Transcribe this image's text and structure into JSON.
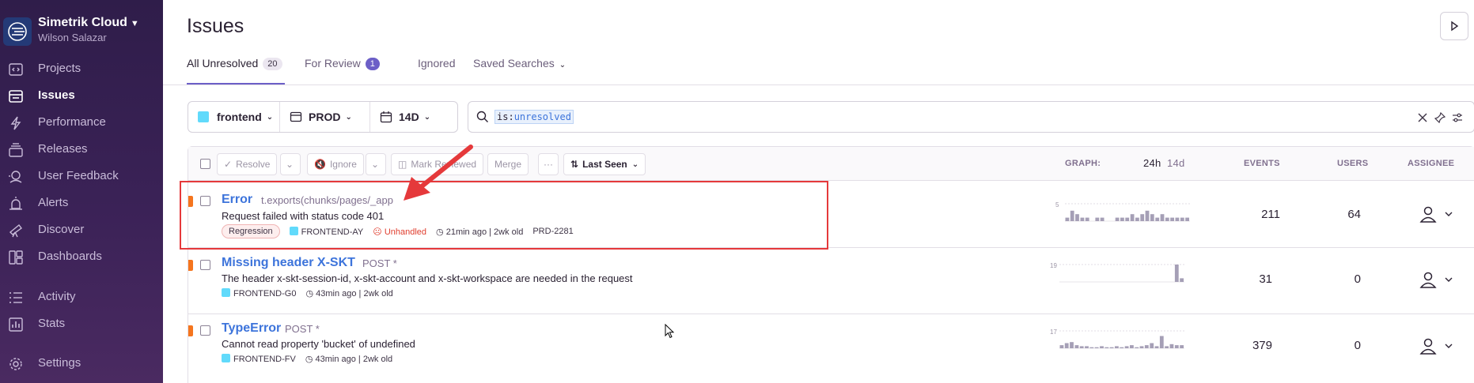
{
  "sidebar": {
    "org_name": "Simetrik Cloud",
    "user_name": "Wilson Salazar",
    "items": [
      {
        "label": "Projects",
        "icon": "code-icon"
      },
      {
        "label": "Issues",
        "icon": "inbox-icon",
        "active": true
      },
      {
        "label": "Performance",
        "icon": "lightning-icon"
      },
      {
        "label": "Releases",
        "icon": "stack-icon"
      },
      {
        "label": "User Feedback",
        "icon": "megaphone-icon"
      },
      {
        "label": "Alerts",
        "icon": "siren-icon"
      },
      {
        "label": "Discover",
        "icon": "telescope-icon"
      },
      {
        "label": "Dashboards",
        "icon": "dashboard-icon"
      },
      {
        "label": "Activity",
        "icon": "list-icon"
      },
      {
        "label": "Stats",
        "icon": "bar-chart-icon"
      },
      {
        "label": "Settings",
        "icon": "gear-icon"
      }
    ]
  },
  "header": {
    "title": "Issues"
  },
  "tabs": [
    {
      "label": "All Unresolved",
      "count": "20",
      "active": true
    },
    {
      "label": "For Review",
      "count": "1"
    },
    {
      "label": "Ignored"
    },
    {
      "label": "Saved Searches"
    }
  ],
  "filters": {
    "project": "frontend",
    "environment": "PROD",
    "period": "14D"
  },
  "search": {
    "key": "is:",
    "value": "unresolved"
  },
  "toolbar": {
    "resolve": "Resolve",
    "ignore": "Ignore",
    "mark_reviewed": "Mark Reviewed",
    "merge": "Merge",
    "more": "···",
    "sort": "Last Seen"
  },
  "columns": {
    "graph": "GRAPH:",
    "graph_24h": "24h",
    "graph_14d": "14d",
    "events": "EVENTS",
    "users": "USERS",
    "assignee": "ASSIGNEE"
  },
  "issues": [
    {
      "title": "Error",
      "culprit": "t.exports(chunks/pages/_app",
      "message": "Request failed with status code 401",
      "badge": "Regression",
      "project": "FRONTEND-AY",
      "handled": "Unhandled",
      "age": "21min ago | 2wk old",
      "ticket": "PRD-2281",
      "events": "211",
      "users": "64",
      "graph_max": "5",
      "spark": [
        1,
        3,
        2,
        1,
        1,
        0,
        1,
        1,
        0,
        0,
        1,
        1,
        1,
        2,
        1,
        2,
        3,
        2,
        1,
        2,
        1,
        1,
        1,
        1,
        1
      ]
    },
    {
      "title": "Missing header X-SKT",
      "culprit": "POST *",
      "message": "The header x-skt-session-id, x-skt-account and x-skt-workspace are needed in the request",
      "project": "FRONTEND-G0",
      "age": "43min ago | 2wk old",
      "events": "31",
      "users": "0",
      "graph_max": "19",
      "spark": [
        0,
        0,
        0,
        0,
        0,
        0,
        0,
        0,
        0,
        0,
        0,
        0,
        0,
        0,
        0,
        0,
        0,
        0,
        0,
        0,
        0,
        0,
        0,
        19,
        4
      ]
    },
    {
      "title": "TypeError",
      "culprit": "POST *",
      "message": "Cannot read property 'bucket' of undefined",
      "project": "FRONTEND-FV",
      "age": "43min ago | 2wk old",
      "events": "379",
      "users": "0",
      "graph_max": "17",
      "spark": [
        3,
        5,
        6,
        3,
        2,
        2,
        1,
        1,
        2,
        1,
        1,
        2,
        1,
        2,
        3,
        1,
        2,
        3,
        5,
        2,
        12,
        2,
        4,
        3,
        3
      ]
    }
  ]
}
